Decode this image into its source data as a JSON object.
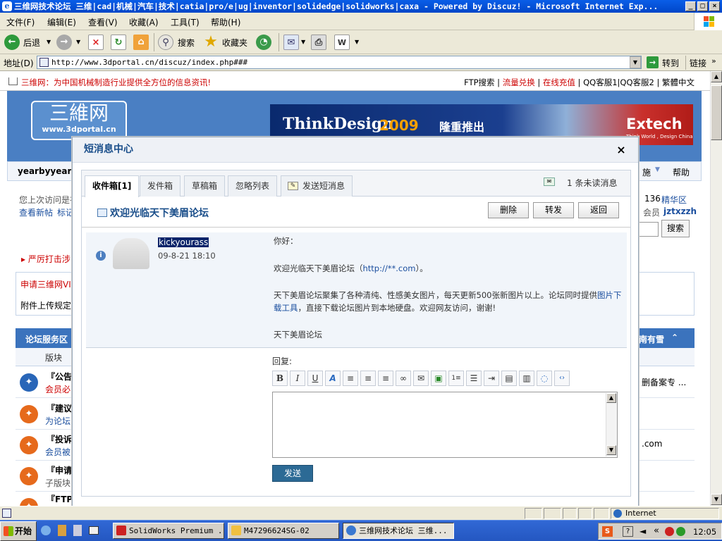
{
  "window": {
    "title": "三维网技术论坛 三维|cad|机械|汽车|技术|catia|pro/e|ug|inventor|solidedge|solidworks|caxa - Powered by Discuz! - Microsoft Internet Exp..."
  },
  "menu": [
    "文件(F)",
    "编辑(E)",
    "查看(V)",
    "收藏(A)",
    "工具(T)",
    "帮助(H)"
  ],
  "toolbar": {
    "back": "后退",
    "search": "搜索",
    "favorites": "收藏夹"
  },
  "address": {
    "label": "地址(D)",
    "url": "http://www.3dportal.cn/discuz/index.php###",
    "go": "转到",
    "links": "链接"
  },
  "site": {
    "slogan": "三维网：为中国机械制造行业提供全方位的信息资讯!",
    "top_links": {
      "ftp": "FTP搜索",
      "traffic": "流量兑换",
      "recharge": "在线充值",
      "qq1": "QQ客服1",
      "qq2": "QQ客服2",
      "trad": "繁體中文"
    },
    "logo_main": "三維网",
    "logo_url": "www.3dportal.cn",
    "ad": {
      "brand": "ThinkDesign",
      "year": "2009",
      "promo": "隆重推出",
      "company": "Extech",
      "tagline": "Think World , Design China"
    },
    "nav_user": "yearbyyear",
    "nav_right1": "施",
    "nav_help": "帮助",
    "bg": {
      "last_visit": "您上次访问是在",
      "new_posts": "查看新帖",
      "mark": "标记",
      "online": "136",
      "elite": "精华区",
      "member_label": "会员",
      "member_name": "jztxzzh",
      "search_btn": "搜索",
      "crackdown": "严厉打击涉",
      "apply_vip": "申请三维网VIP",
      "attach": "附件上传规定",
      "svc_title": "论坛服务区",
      "board": "版块",
      "svc_right": "南有雪",
      "row1_title": "『公告",
      "row1_sub": "会员必",
      "row1_right": "删备案专 ...",
      "row2_title": "『建议",
      "row2_sub": "为论坛",
      "row3_title": "『投诉",
      "row3_sub": "会员被",
      "row3_right": ".com",
      "row4_title": "『申请",
      "row4_sub": "子版块",
      "row5_title": "『FTP"
    }
  },
  "modal": {
    "title": "短消息中心",
    "close": "×",
    "tabs": [
      "收件箱[1]",
      "发件箱",
      "草稿箱",
      "忽略列表",
      "发送短消息"
    ],
    "unread": "1 条未读消息",
    "subject": "欢迎光临天下美眉论坛",
    "buttons": {
      "delete": "删除",
      "forward": "转发",
      "back": "返回"
    },
    "sender": "kickyourass",
    "time": "09-8-21 18:10",
    "body": {
      "greeting": "你好：",
      "welcome_pre": "欢迎光临天下美眉论坛（",
      "welcome_link": "http://**.com",
      "welcome_post": "）。",
      "para_pre": "天下美眉论坛聚集了各种清纯、性感美女图片，每天更新500张新图片以上。论坛同时提供",
      "para_link": "图片下载工具",
      "para_post": "，直接下载论坛图片到本地硬盘。欢迎网友访问，谢谢!",
      "signature": "天下美眉论坛"
    },
    "reply_label": "回复:",
    "send": "发送"
  },
  "statusbar": {
    "zone": "Internet"
  },
  "taskbar": {
    "start": "开始",
    "tasks": [
      "SolidWorks Premium ...",
      "M47296624SG-02",
      "三维网技术论坛 三维..."
    ],
    "clock": "12:05"
  },
  "colors": {
    "accent": "#3b73bd",
    "link": "#1a4e9e",
    "selection": "#0a246a",
    "send_button": "#2c6a95"
  }
}
